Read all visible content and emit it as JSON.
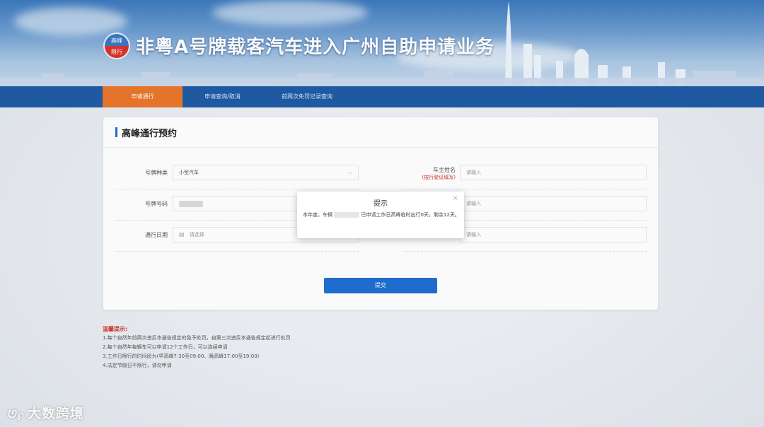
{
  "header": {
    "logo_top": "高峰",
    "logo_bottom": "限行",
    "title": "非粤A号牌载客汽车进入广州自助申请业务"
  },
  "nav": {
    "items": [
      {
        "label": "申请通行"
      },
      {
        "label": "申请查询/取消"
      },
      {
        "label": "前两次免罚记录查询"
      }
    ]
  },
  "form": {
    "title": "高峰通行预约",
    "plate_type_label": "号牌种类",
    "plate_type_value": "小型汽车",
    "plate_number_label": "号牌号码",
    "pass_date_label": "通行日期",
    "pass_date_placeholder": "请选择",
    "owner_name_label": "车主姓名",
    "owner_name_note": "(按行驶证填写)",
    "owner_name_placeholder": "请输入",
    "right_field2_placeholder": "请输入",
    "right_field3_placeholder": "请输入",
    "submit_label": "提交"
  },
  "tips": {
    "title": "温馨提示:",
    "lines": [
      "1.每个自然年前两次违反本通告规定的免予处罚，自第三次违反本通告规定起进行处罚",
      "2.每个自然年每辆车可以申请12个工作日，可以连续申请",
      "3.工作日限行的时间段为(早高峰7:30至09:00、晚高峰17:00至19:00)",
      "4.法定节假日不限行，请勿申请"
    ]
  },
  "dialog": {
    "title": "提示",
    "close": "×",
    "text_before": "本年度，车辆",
    "text_after": "已申请工作日高峰临时出行0天，剩余12天。"
  },
  "watermark": {
    "logo": "ᘎ℘",
    "text": "大数跨境"
  },
  "colors": {
    "nav_bg": "#1f5ba6",
    "nav_active": "#e8772b",
    "primary": "#1f6fd1",
    "warning": "#d0342c"
  }
}
